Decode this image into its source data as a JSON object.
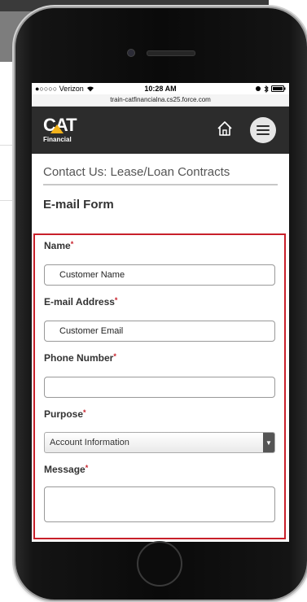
{
  "status_bar": {
    "carrier": "●○○○○ Verizon",
    "time": "10:28 AM",
    "url": "train-catfinancialna.cs25.force.com"
  },
  "brand": {
    "logo_main": "CAT",
    "logo_sub": "Financial",
    "accent": "#f2b21b"
  },
  "header": {
    "home_icon": "home-icon",
    "menu_icon": "hamburger-menu-icon"
  },
  "page": {
    "title": "Contact Us: Lease/Loan Contracts",
    "form_title": "E-mail Form"
  },
  "form": {
    "name": {
      "label": "Name",
      "value": "Customer Name"
    },
    "email": {
      "label": "E-mail Address",
      "value": "Customer Email"
    },
    "phone": {
      "label": "Phone Number",
      "value": ""
    },
    "purpose": {
      "label": "Purpose",
      "selected": "Account Information"
    },
    "message": {
      "label": "Message",
      "value": ""
    },
    "required_mark": "*",
    "highlight_color": "#c8202a"
  }
}
